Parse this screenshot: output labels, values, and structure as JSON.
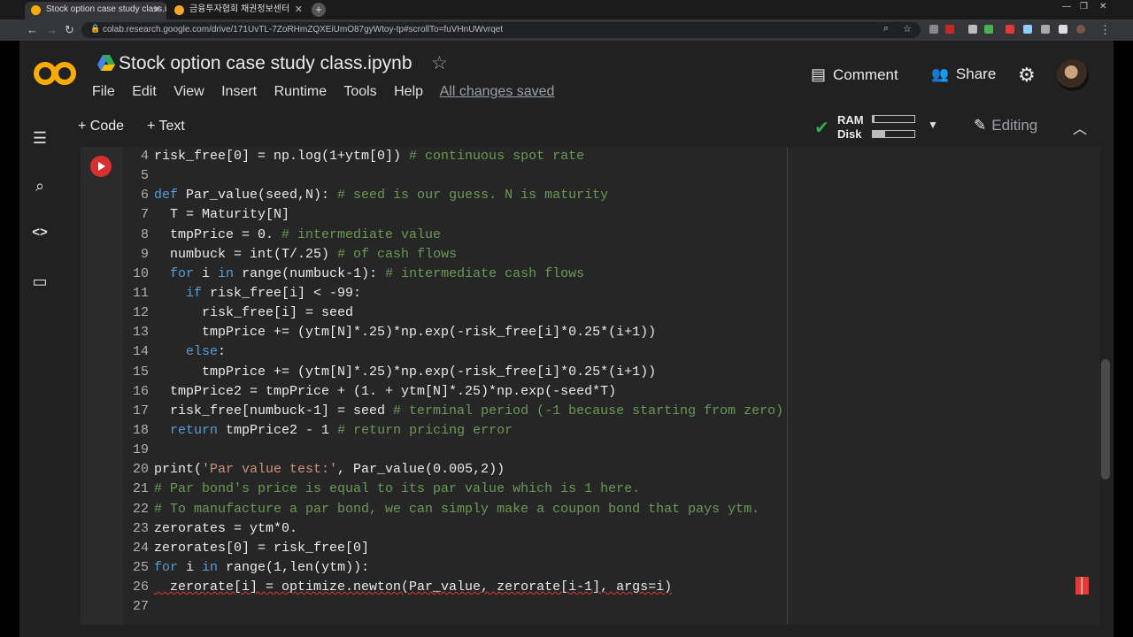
{
  "browser": {
    "tabs": [
      {
        "label": "Stock option case study class.ip",
        "active": true,
        "favicon_color": "#f9ab00"
      },
      {
        "label": "금융투자협회 채권정보센터",
        "active": false,
        "favicon_color": "#f9a825"
      }
    ],
    "url": "colab.research.google.com/drive/171UvTL-7ZoRHmZQXEiUmO87gyWtoy-tp#scrollTo=fuVHnUWvrqet",
    "icons": [
      "back-icon",
      "forward-icon",
      "reload-icon",
      "lock-icon",
      "search-icon",
      "star-icon"
    ]
  },
  "app": {
    "title": "Stock option case study class.ipynb",
    "menu": [
      "File",
      "Edit",
      "View",
      "Insert",
      "Runtime",
      "Tools",
      "Help"
    ],
    "save_status": "All changes saved",
    "comment_label": "Comment",
    "share_label": "Share",
    "add_code_label": "+ Code",
    "add_text_label": "+ Text",
    "ram_label": "RAM",
    "disk_label": "Disk",
    "ram_usage": 0.04,
    "disk_usage": 0.3,
    "editing_label": "Editing",
    "colors": {
      "logo_orange": "#f9ab00",
      "run_button": "#d63031",
      "check_green": "#34a853"
    }
  },
  "code_lines": [
    {
      "n": "4",
      "tokens": [
        {
          "t": "risk_free[0] = np.log(1+ytm[0]) ",
          "c": "pl"
        },
        {
          "t": "# continuous spot rate",
          "c": "cm"
        }
      ]
    },
    {
      "n": "5",
      "tokens": []
    },
    {
      "n": "6",
      "tokens": [
        {
          "t": "def ",
          "c": "kw"
        },
        {
          "t": "Par_value(seed,N): ",
          "c": "pl"
        },
        {
          "t": "# seed is our guess. N is maturity",
          "c": "cm"
        }
      ]
    },
    {
      "n": "7",
      "tokens": [
        {
          "t": "  T = Maturity[N]",
          "c": "pl"
        }
      ]
    },
    {
      "n": "8",
      "tokens": [
        {
          "t": "  tmpPrice = 0. ",
          "c": "pl"
        },
        {
          "t": "# intermediate value",
          "c": "cm"
        }
      ]
    },
    {
      "n": "9",
      "tokens": [
        {
          "t": "  numbuck = int(T/.25) ",
          "c": "pl"
        },
        {
          "t": "# of cash flows",
          "c": "cm"
        }
      ]
    },
    {
      "n": "10",
      "tokens": [
        {
          "t": "  ",
          "c": "pl"
        },
        {
          "t": "for ",
          "c": "kw"
        },
        {
          "t": "i ",
          "c": "pl"
        },
        {
          "t": "in ",
          "c": "kw"
        },
        {
          "t": "range(numbuck-1): ",
          "c": "pl"
        },
        {
          "t": "# intermediate cash flows",
          "c": "cm"
        }
      ]
    },
    {
      "n": "11",
      "tokens": [
        {
          "t": "    ",
          "c": "pl"
        },
        {
          "t": "if ",
          "c": "kw"
        },
        {
          "t": "risk_free[i] < -99:",
          "c": "pl"
        }
      ]
    },
    {
      "n": "12",
      "tokens": [
        {
          "t": "      risk_free[i] = seed",
          "c": "pl"
        }
      ]
    },
    {
      "n": "13",
      "tokens": [
        {
          "t": "      tmpPrice += (ytm[N]*.25)*np.exp(-risk_free[i]*0.25*(i+1))",
          "c": "pl"
        }
      ]
    },
    {
      "n": "14",
      "tokens": [
        {
          "t": "    ",
          "c": "pl"
        },
        {
          "t": "else",
          "c": "kw"
        },
        {
          "t": ":",
          "c": "pl"
        }
      ]
    },
    {
      "n": "15",
      "tokens": [
        {
          "t": "      tmpPrice += (ytm[N]*.25)*np.exp(-risk_free[i]*0.25*(i+1))",
          "c": "pl"
        }
      ]
    },
    {
      "n": "16",
      "tokens": [
        {
          "t": "  tmpPrice2 = tmpPrice + (1. + ytm[N]*.25)*np.exp(-seed*T)",
          "c": "pl"
        }
      ]
    },
    {
      "n": "17",
      "tokens": [
        {
          "t": "  risk_free[numbuck-1] = seed ",
          "c": "pl"
        },
        {
          "t": "# terminal period (-1 because starting from zero)",
          "c": "cm"
        }
      ]
    },
    {
      "n": "18",
      "tokens": [
        {
          "t": "  ",
          "c": "pl"
        },
        {
          "t": "return ",
          "c": "kw"
        },
        {
          "t": "tmpPrice2 - 1 ",
          "c": "pl"
        },
        {
          "t": "# return pricing error",
          "c": "cm"
        }
      ]
    },
    {
      "n": "19",
      "tokens": []
    },
    {
      "n": "20",
      "tokens": [
        {
          "t": "print(",
          "c": "pl"
        },
        {
          "t": "'Par value test:'",
          "c": "str"
        },
        {
          "t": ", Par_value(0.005,2))",
          "c": "pl"
        }
      ]
    },
    {
      "n": "21",
      "tokens": [
        {
          "t": "# Par bond's price is equal to its par value which is 1 here.",
          "c": "cm"
        }
      ]
    },
    {
      "n": "22",
      "tokens": [
        {
          "t": "# To manufacture a par bond, we can simply make a coupon bond that pays ytm.",
          "c": "cm"
        }
      ]
    },
    {
      "n": "23",
      "tokens": [
        {
          "t": "zerorates = ytm*0.",
          "c": "pl"
        }
      ]
    },
    {
      "n": "24",
      "tokens": [
        {
          "t": "zerorates[0] = risk_free[0]",
          "c": "pl"
        }
      ]
    },
    {
      "n": "25",
      "tokens": [
        {
          "t": "for ",
          "c": "kw"
        },
        {
          "t": "i ",
          "c": "pl"
        },
        {
          "t": "in ",
          "c": "kw"
        },
        {
          "t": "range(1,len(ytm)):",
          "c": "pl"
        }
      ]
    },
    {
      "n": "26",
      "tokens": [
        {
          "t": "  zerorate[i] = optimize.newton(Par_value, zerorate[i-1], args=i)",
          "c": "pl squig"
        }
      ]
    },
    {
      "n": "27",
      "tokens": []
    }
  ]
}
